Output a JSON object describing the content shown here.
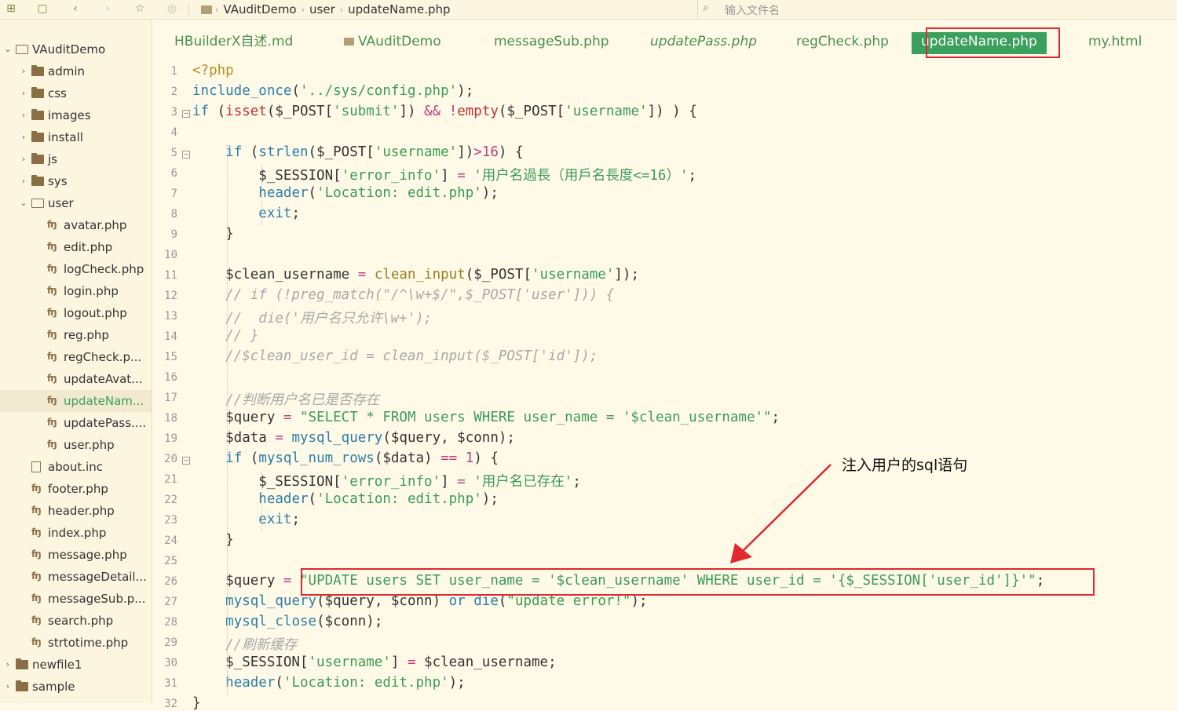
{
  "toolbar": {
    "breadcrumb": [
      "VAuditDemo",
      "user",
      "updateName.php"
    ],
    "search_placeholder": "输入文件名"
  },
  "sidebar": {
    "items": [
      {
        "label": "VAuditDemo",
        "type": "folder-open",
        "depth": 0,
        "expanded": true
      },
      {
        "label": "admin",
        "type": "folder",
        "depth": 1
      },
      {
        "label": "css",
        "type": "folder",
        "depth": 1
      },
      {
        "label": "images",
        "type": "folder",
        "depth": 1
      },
      {
        "label": "install",
        "type": "folder",
        "depth": 1
      },
      {
        "label": "js",
        "type": "folder",
        "depth": 1
      },
      {
        "label": "sys",
        "type": "folder",
        "depth": 1
      },
      {
        "label": "user",
        "type": "folder-open",
        "depth": 1,
        "expanded": true
      },
      {
        "label": "avatar.php",
        "type": "php",
        "depth": 2
      },
      {
        "label": "edit.php",
        "type": "php",
        "depth": 2
      },
      {
        "label": "logCheck.php",
        "type": "php",
        "depth": 2
      },
      {
        "label": "login.php",
        "type": "php",
        "depth": 2
      },
      {
        "label": "logout.php",
        "type": "php",
        "depth": 2
      },
      {
        "label": "reg.php",
        "type": "php",
        "depth": 2
      },
      {
        "label": "regCheck.p...",
        "type": "php",
        "depth": 2
      },
      {
        "label": "updateAvat...",
        "type": "php",
        "depth": 2
      },
      {
        "label": "updateNam...",
        "type": "php",
        "depth": 2,
        "selected": true
      },
      {
        "label": "updatePass....",
        "type": "php",
        "depth": 2
      },
      {
        "label": "user.php",
        "type": "php",
        "depth": 2
      },
      {
        "label": "about.inc",
        "type": "file",
        "depth": 1
      },
      {
        "label": "footer.php",
        "type": "php",
        "depth": 1
      },
      {
        "label": "header.php",
        "type": "php",
        "depth": 1
      },
      {
        "label": "index.php",
        "type": "php",
        "depth": 1
      },
      {
        "label": "message.php",
        "type": "php",
        "depth": 1
      },
      {
        "label": "messageDetail...",
        "type": "php",
        "depth": 1
      },
      {
        "label": "messageSub.p...",
        "type": "php",
        "depth": 1
      },
      {
        "label": "search.php",
        "type": "php",
        "depth": 1
      },
      {
        "label": "strtotime.php",
        "type": "php",
        "depth": 1
      },
      {
        "label": "newfile1",
        "type": "folder",
        "depth": 0
      },
      {
        "label": "sample",
        "type": "folder",
        "depth": 0
      }
    ]
  },
  "tabs": [
    {
      "label": "HBuilderX自述.md"
    },
    {
      "label": "VAuditDemo",
      "folder": true
    },
    {
      "label": "messageSub.php"
    },
    {
      "label": "updatePass.php",
      "italic": true
    },
    {
      "label": "regCheck.php"
    },
    {
      "label": "updateName.php",
      "active": true
    },
    {
      "label": "my.html"
    }
  ],
  "annotation": {
    "text": "注入用户的sql语句",
    "color": "#e0282e"
  },
  "colors": {
    "accent": "#3aa05b",
    "background": "#fffae8",
    "highlight": "#e0282e"
  },
  "code": {
    "line_numbers": [
      "1",
      "2",
      "3",
      "4",
      "5",
      "6",
      "7",
      "8",
      "9",
      "10",
      "11",
      "12",
      "13",
      "14",
      "15",
      "16",
      "17",
      "18",
      "19",
      "20",
      "21",
      "22",
      "23",
      "24",
      "25",
      "26",
      "27",
      "28",
      "29",
      "30",
      "31",
      "32"
    ],
    "lines": [
      "<?php",
      "include_once('../sys/config.php');",
      "if (isset($_POST['submit']) && !empty($_POST['username']) ) {",
      "",
      "    if (strlen($_POST['username'])>16) {",
      "        $_SESSION['error_info'] = '用户名過長（用戶名長度<=16）';",
      "        header('Location: edit.php');",
      "        exit;",
      "    }",
      "",
      "    $clean_username = clean_input($_POST['username']);",
      "    // if (!preg_match(\"/^\\w+$/\",$_POST['user'])) {",
      "    //  die('用户名只允许\\w+');",
      "    // }",
      "    //$clean_user_id = clean_input($_POST['id']);",
      "",
      "    //判断用户名已是否存在",
      "    $query = \"SELECT * FROM users WHERE user_name = '$clean_username'\";",
      "    $data = mysql_query($query, $conn);",
      "    if (mysql_num_rows($data) == 1) {",
      "        $_SESSION['error_info'] = '用户名已存在';",
      "        header('Location: edit.php');",
      "        exit;",
      "    }",
      "",
      "    $query = \"UPDATE users SET user_name = '$clean_username' WHERE user_id = '{$_SESSION['user_id']}'\";",
      "    mysql_query($query, $conn) or die(\"update error!\");",
      "    mysql_close($conn);",
      "    //刷新缓存",
      "    $_SESSION['username'] = $clean_username;",
      "    header('Location: edit.php');",
      "}"
    ]
  }
}
